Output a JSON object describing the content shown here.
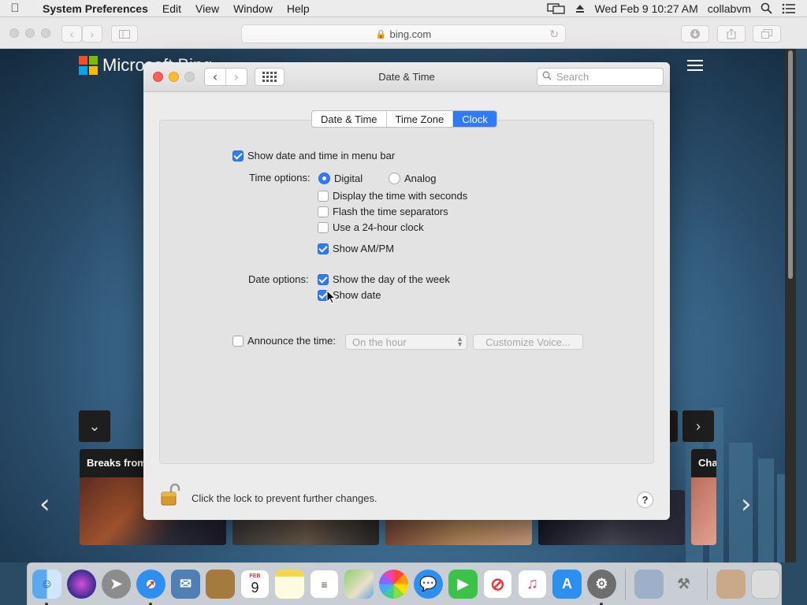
{
  "menubar": {
    "app_name": "System Preferences",
    "items": [
      "Edit",
      "View",
      "Window",
      "Help"
    ],
    "datetime": "Wed Feb 9  10:27 AM",
    "user": "collabvm"
  },
  "safari": {
    "url": "bing.com"
  },
  "webpage": {
    "logo_text": "Microsoft Bing",
    "card1_title": "Breaks from",
    "card2_title": "Cha"
  },
  "window": {
    "title": "Date & Time",
    "search_placeholder": "Search",
    "tabs": [
      "Date & Time",
      "Time Zone",
      "Clock"
    ],
    "active_tab": "Clock"
  },
  "clock": {
    "show_in_menubar": {
      "label": "Show date and time in menu bar",
      "checked": true
    },
    "time_options_label": "Time options:",
    "digital": {
      "label": "Digital",
      "selected": true
    },
    "analog": {
      "label": "Analog",
      "selected": false
    },
    "seconds": {
      "label": "Display the time with seconds",
      "checked": false
    },
    "flash": {
      "label": "Flash the time separators",
      "checked": false
    },
    "hour24": {
      "label": "Use a 24-hour clock",
      "checked": false
    },
    "ampm": {
      "label": "Show AM/PM",
      "checked": true
    },
    "date_options_label": "Date options:",
    "day_of_week": {
      "label": "Show the day of the week",
      "checked": true
    },
    "show_date": {
      "label": "Show date",
      "checked": true
    },
    "announce": {
      "label": "Announce the time:",
      "checked": false
    },
    "announce_interval": "On the hour",
    "customize_voice": "Customize Voice..."
  },
  "footer": {
    "lock_text": "Click the lock to prevent further changes.",
    "help": "?"
  },
  "dock": {
    "calendar_month": "FEB",
    "calendar_day": "9"
  }
}
